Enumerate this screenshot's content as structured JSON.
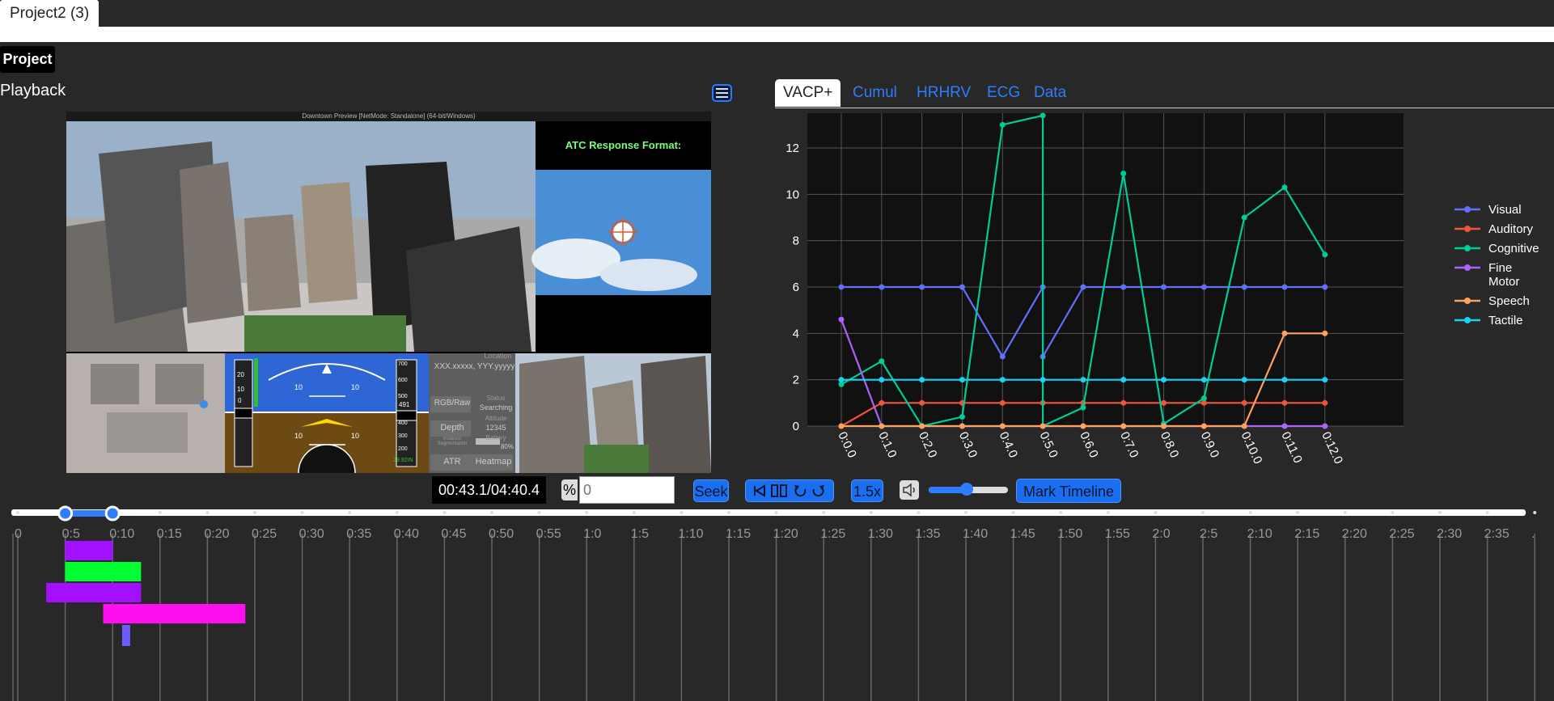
{
  "window": {
    "tab_title": "Project2 (3)"
  },
  "project": {
    "button_label": "Project"
  },
  "playback": {
    "section_label": "Playback",
    "video_title": "Downtown Preview [NetMode: Standalone] (64-bit/Windows)",
    "atc_label": "ATC Response Format:",
    "hud": {
      "location_label": "Location",
      "location_value": "XXX.xxxxx, YYY.yyyyy",
      "rgb_raw": "RGB/Raw",
      "status_label": "Status",
      "status_value": "Searching",
      "depth": "Depth",
      "altitude_label": "Altitude",
      "altitude_value": "12345",
      "battery_label": "Battery",
      "battery_value": "80%",
      "segmentation": "Instance Segmentation",
      "atr": "ATR",
      "heatmap": "Heatmap",
      "pfd_pitch_upper": "10",
      "pfd_pitch_lower": "10",
      "pfd_speed_value": "0",
      "pfd_alt_value": "491",
      "pfd_baro": "29.92IN",
      "pfd_speed_ticks": [
        "20",
        "10",
        "0"
      ],
      "pfd_alt_ticks": [
        "700",
        "600",
        "500",
        "400",
        "300",
        "200"
      ]
    }
  },
  "chart_tabs": [
    {
      "label": "VACP+",
      "active": true
    },
    {
      "label": "Cumul",
      "active": false
    },
    {
      "label": "HRHRV",
      "active": false
    },
    {
      "label": "ECG",
      "active": false
    },
    {
      "label": "Data",
      "active": false
    }
  ],
  "chart_data": {
    "type": "line",
    "x": [
      "0:0.0",
      "0:1.0",
      "0:2.0",
      "0:3.0",
      "0:4.0",
      "0:5.0",
      "0:6.0",
      "0:7.0",
      "0:8.0",
      "0:9.0",
      "0:10.0",
      "0:11.0",
      "0:12.0"
    ],
    "yticks": [
      0,
      2,
      4,
      6,
      8,
      10,
      12
    ],
    "ylim": [
      0,
      13.5
    ],
    "grid": true,
    "legend_position": "right",
    "series": [
      {
        "name": "Visual",
        "color": "#636efa",
        "points": [
          [
            0,
            6
          ],
          [
            1,
            6
          ],
          [
            2,
            6
          ],
          [
            3,
            6
          ],
          [
            4,
            3
          ],
          [
            5,
            6
          ],
          [
            5,
            3
          ],
          [
            6,
            6
          ],
          [
            7,
            6
          ],
          [
            8,
            6
          ],
          [
            9,
            6
          ],
          [
            10,
            6
          ],
          [
            11,
            6
          ],
          [
            12,
            6
          ]
        ]
      },
      {
        "name": "Auditory",
        "color": "#ef553b",
        "points": [
          [
            0,
            0
          ],
          [
            1,
            1
          ],
          [
            2,
            1
          ],
          [
            3,
            1
          ],
          [
            4,
            1
          ],
          [
            5,
            1
          ],
          [
            6,
            1
          ],
          [
            7,
            1
          ],
          [
            8,
            1
          ],
          [
            9,
            1
          ],
          [
            10,
            1
          ],
          [
            11,
            1
          ],
          [
            12,
            1
          ]
        ]
      },
      {
        "name": "Cognitive",
        "color": "#00cc96",
        "points": [
          [
            0,
            1.8
          ],
          [
            1,
            2.8
          ],
          [
            2,
            0
          ],
          [
            3,
            0.4
          ],
          [
            4,
            13
          ],
          [
            5,
            13.4
          ],
          [
            5,
            0
          ],
          [
            6,
            0.8
          ],
          [
            7,
            10.9
          ],
          [
            8,
            0.1
          ],
          [
            9,
            1.2
          ],
          [
            10,
            9
          ],
          [
            11,
            10.3
          ],
          [
            12,
            7.4
          ]
        ]
      },
      {
        "name": "Fine\nMotor",
        "color": "#ab63fa",
        "points": [
          [
            0,
            4.6
          ],
          [
            1,
            0
          ],
          [
            2,
            0
          ],
          [
            3,
            0
          ],
          [
            4,
            0
          ],
          [
            5,
            0
          ],
          [
            6,
            0
          ],
          [
            7,
            0
          ],
          [
            8,
            0
          ],
          [
            9,
            0
          ],
          [
            10,
            0
          ],
          [
            11,
            0
          ],
          [
            12,
            0
          ]
        ]
      },
      {
        "name": "Speech",
        "color": "#ffa15a",
        "points": [
          [
            0,
            0
          ],
          [
            1,
            0
          ],
          [
            2,
            0
          ],
          [
            3,
            0
          ],
          [
            4,
            0
          ],
          [
            5,
            0
          ],
          [
            6,
            0
          ],
          [
            7,
            0
          ],
          [
            8,
            0
          ],
          [
            9,
            0
          ],
          [
            10,
            0
          ],
          [
            11,
            4
          ],
          [
            12,
            4
          ]
        ]
      },
      {
        "name": "Tactile",
        "color": "#19d3f3",
        "points": [
          [
            0,
            2
          ],
          [
            1,
            2
          ],
          [
            2,
            2
          ],
          [
            3,
            2
          ],
          [
            4,
            2
          ],
          [
            5,
            2
          ],
          [
            6,
            2
          ],
          [
            7,
            2
          ],
          [
            8,
            2
          ],
          [
            9,
            2
          ],
          [
            10,
            2
          ],
          [
            11,
            2
          ],
          [
            12,
            2
          ]
        ]
      }
    ]
  },
  "controls": {
    "time": "00:43.1/04:40.4",
    "percent_symbol": "%",
    "seek_placeholder": "0",
    "seek_label": "Seek",
    "speed_label": "1.5x",
    "volume_fraction": 0.48,
    "mark_timeline_label": "Mark Timeline"
  },
  "timeline": {
    "labels": [
      "0",
      "0:5",
      "0:10",
      "0:15",
      "0:20",
      "0:25",
      "0:30",
      "0:35",
      "0:40",
      "0:45",
      "0:50",
      "0:55",
      "1:0",
      "1:5",
      "1:10",
      "1:15",
      "1:20",
      "1:25",
      "1:30",
      "1:35",
      "1:40",
      "1:45",
      "1:50",
      "1:55",
      "2:0",
      "2:5",
      "2:10",
      "2:15",
      "2:20",
      "2:25",
      "2:30",
      "2:35",
      "."
    ],
    "selection_start_seconds": 5,
    "selection_end_seconds": 10,
    "bars": [
      {
        "start": 5,
        "end": 10,
        "row": 0,
        "color": "#a310ff"
      },
      {
        "start": 5,
        "end": 13,
        "row": 1,
        "color": "#00ff33"
      },
      {
        "start": 3,
        "end": 13,
        "row": 2,
        "color": "#a310ff"
      },
      {
        "start": 9,
        "end": 24,
        "row": 3,
        "color": "#ff0ff0"
      },
      {
        "start": 11,
        "end": 12,
        "row": 4,
        "color": "#6f5bff"
      }
    ]
  }
}
